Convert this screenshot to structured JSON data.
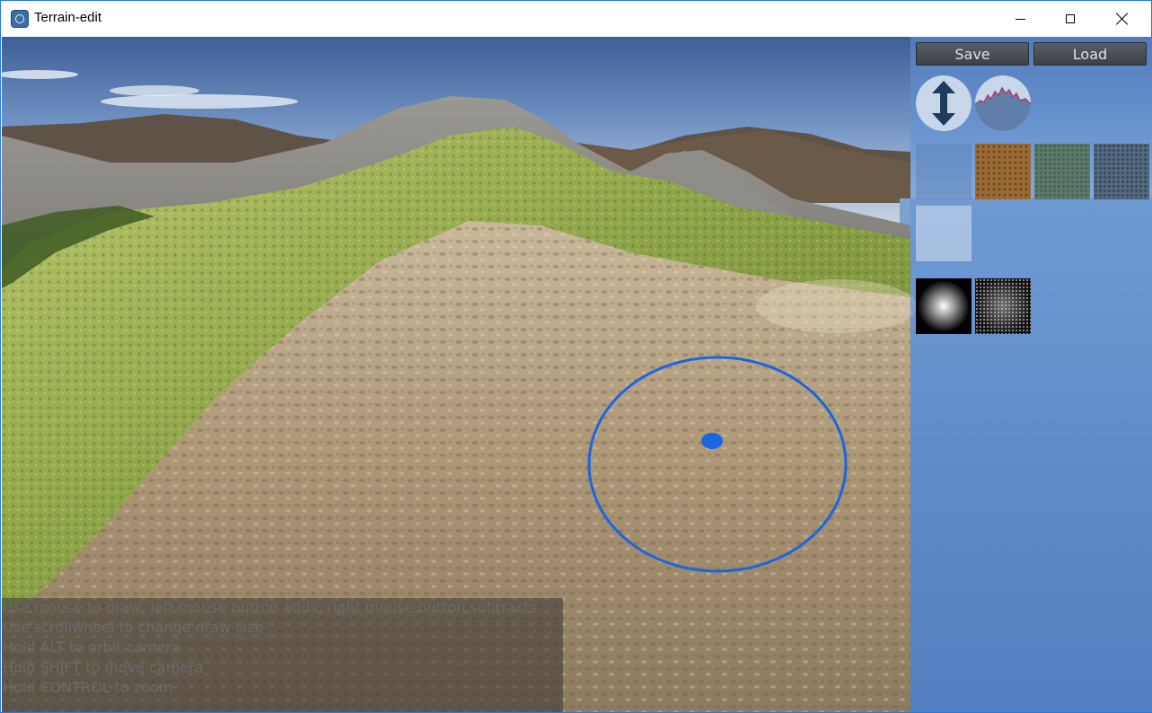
{
  "window": {
    "title": "Terrain-edit",
    "app_icon": "app-icon",
    "controls": [
      "minimize-icon",
      "maximize-icon",
      "close-icon"
    ]
  },
  "toolbar": {
    "save_label": "Save",
    "load_label": "Load"
  },
  "tools": [
    {
      "name": "raise-lower-tool",
      "icon": "up-down-arrow-icon"
    },
    {
      "name": "noise-tool",
      "icon": "noise-terrain-icon"
    }
  ],
  "textures": [
    "empty-texture",
    "sand-texture",
    "grass-texture",
    "rock-texture"
  ],
  "extra_texture_slot": "empty-slot",
  "brushes": [
    "soft-round-brush",
    "noise-brush"
  ],
  "brush_cursor_color": "#1a66e0",
  "instructions": [
    "Use mouse to draw, left mouse button adds, right mouse button subtracts",
    "Use scrollwheel to change draw size",
    "Hold ALT to orbit camera",
    "Hold SHIFT to move camera",
    "Hold CONTROL to zoom"
  ]
}
